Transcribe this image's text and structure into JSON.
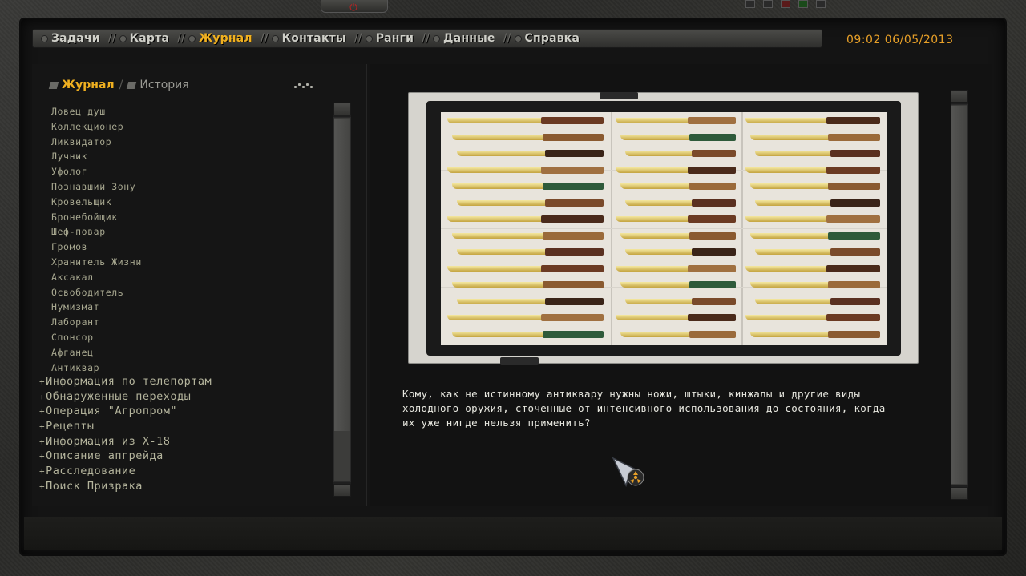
{
  "nav": {
    "tabs": [
      {
        "label": "Задачи",
        "active": false
      },
      {
        "label": "Карта",
        "active": false
      },
      {
        "label": "Журнал",
        "active": true
      },
      {
        "label": "Контакты",
        "active": false
      },
      {
        "label": "Ранги",
        "active": false
      },
      {
        "label": "Данные",
        "active": false
      },
      {
        "label": "Справка",
        "active": false
      }
    ]
  },
  "clock": {
    "time_date": "09:02  06/05/2013"
  },
  "subtabs": {
    "journal": "Журнал",
    "history": "История"
  },
  "journal_entries": [
    "Ловец душ",
    "Коллекционер",
    "Ликвидатор",
    "Лучник",
    "Уфолог",
    "Познавший Зону",
    "Кровельщик",
    "Бронебойщик",
    "Шеф-повар",
    "Громов",
    "Хранитель Жизни",
    "Аксакал",
    "Освободитель",
    "Нумизмат",
    "Лаборант",
    "Спонсор",
    "Афганец",
    "Антиквар"
  ],
  "sections": [
    "Информация по телепортам",
    "Обнаруженные переходы",
    "Операция \"Агропром\"",
    "Рецепты",
    "Информация из Х-18",
    "Описание апгрейда",
    "Расследование",
    "Поиск Призрака"
  ],
  "description": {
    "lines": [
      "Кому, как не истинному антиквару нужны ножи, штыки, кинжалы и другие виды",
      "холодного оружия, сточенные от интенсивного использования до состояния, когда",
      "их уже нигде нельзя применить?"
    ]
  },
  "colors": {
    "accent": "#f0b020",
    "text": "#b4b49c",
    "clock": "#e8a028"
  }
}
